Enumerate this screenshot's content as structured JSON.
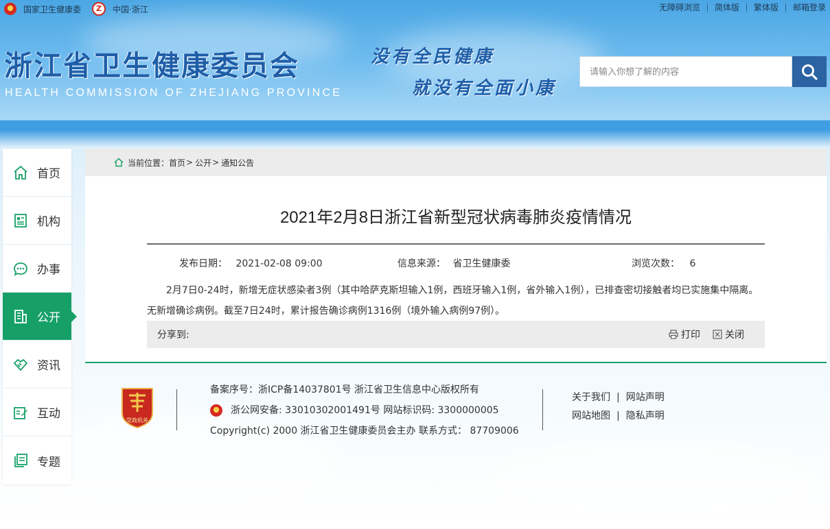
{
  "topbar": {
    "org_name": "国家卫生健康委",
    "region": "中国·浙江",
    "links": [
      "无障碍浏览",
      "简体版",
      "繁体版",
      "邮箱登录"
    ]
  },
  "header": {
    "title": "浙江省卫生健康委员会",
    "title_en": "HEALTH COMMISSION OF ZHEJIANG PROVINCE",
    "slogan_line1": "没有全民健康",
    "slogan_line2": "就没有全面小康",
    "search_placeholder": "请输入你想了解的内容"
  },
  "nav": {
    "items": [
      {
        "label": "首页",
        "icon": "home-icon",
        "active": false
      },
      {
        "label": "机构",
        "icon": "document-icon",
        "active": false
      },
      {
        "label": "办事",
        "icon": "chat-icon",
        "active": false
      },
      {
        "label": "公开",
        "icon": "building-icon",
        "active": true
      },
      {
        "label": "资讯",
        "icon": "handshake-icon",
        "active": false
      },
      {
        "label": "互动",
        "icon": "edit-icon",
        "active": false
      },
      {
        "label": "专题",
        "icon": "notes-icon",
        "active": false
      }
    ]
  },
  "breadcrumb": {
    "prefix": "当前位置：",
    "items": [
      "首页",
      "公开",
      "通知公告"
    ]
  },
  "article": {
    "title": "2021年2月8日浙江省新型冠状病毒肺炎疫情情况",
    "date_label": "发布日期：",
    "date": "2021-02-08 09:00",
    "source_label": "信息来源：",
    "source": "省卫生健康委",
    "views_label": "浏览次数：",
    "views": "6",
    "body": "2月7日0-24时，新增无症状感染者3例（其中哈萨克斯坦输入1例，西班牙输入1例，省外输入1例），已排查密切接触者均已实施集中隔离。无新增确诊病例。截至7日24时，累计报告确诊病例1316例（境外输入病例97例）。",
    "share_label": "分享到:",
    "print_label": "打印",
    "close_label": "关闭"
  },
  "footer": {
    "badge_text": "党政机关",
    "icp": "备案序号：浙ICP备14037801号  浙江省卫生信息中心版权所有",
    "police": "浙公网安备: 33010302001491号 网站标识码: 3300000005",
    "copyright": "Copyright(c) 2000 浙江省卫生健康委员会主办 联系方式： 87709006",
    "links": [
      "关于我们",
      "网站声明",
      "网站地图",
      "隐私声明"
    ]
  },
  "colors": {
    "accent_green": "#16a068",
    "brand_blue": "#1f5ea8",
    "search_button": "#2b63a3"
  }
}
